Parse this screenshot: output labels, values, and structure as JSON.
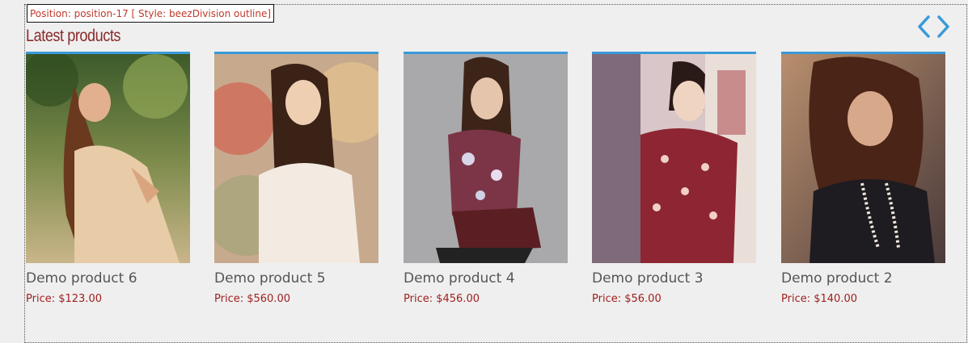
{
  "module": {
    "position_label": "Position: position-17 [ Style: beezDivision outline]",
    "title": "Latest products"
  },
  "nav": {
    "prev_icon": "chevron-left-icon",
    "next_icon": "chevron-right-icon",
    "color": "#3a9ad9"
  },
  "products": [
    {
      "name": "Demo product 6",
      "price": "Price: $123.00"
    },
    {
      "name": "Demo product 5",
      "price": "Price: $560.00"
    },
    {
      "name": "Demo product 4",
      "price": "Price: $456.00"
    },
    {
      "name": "Demo product 3",
      "price": "Price: $56.00"
    },
    {
      "name": "Demo product 2",
      "price": "Price: $140.00"
    }
  ],
  "colors": {
    "accent": "#3a9ad9",
    "price": "#a01f1f",
    "title": "#8a2a2a"
  }
}
